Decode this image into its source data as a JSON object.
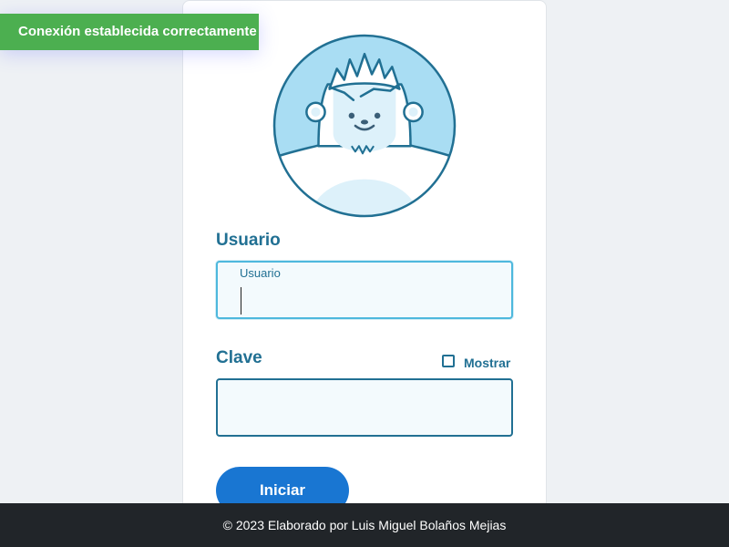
{
  "toast": {
    "message": "Conexión establecida correctamente",
    "color": "#4caf50"
  },
  "login": {
    "avatar_icon": "yeti-avatar-icon",
    "username": {
      "label": "Usuario",
      "floating_label": "Usuario",
      "value": ""
    },
    "password": {
      "label": "Clave",
      "value": "",
      "show_toggle_label": "Mostrar",
      "show_checked": false
    },
    "submit_label": "Iniciar"
  },
  "footer": {
    "text": "© 2023 Elaborado por Luis Miguel Bolaños Mejias"
  },
  "colors": {
    "accent": "#217093",
    "focus_border": "#4eb8dd",
    "button": "#1976d2",
    "footer_bg": "#212529",
    "page_bg": "#eef1f4"
  }
}
